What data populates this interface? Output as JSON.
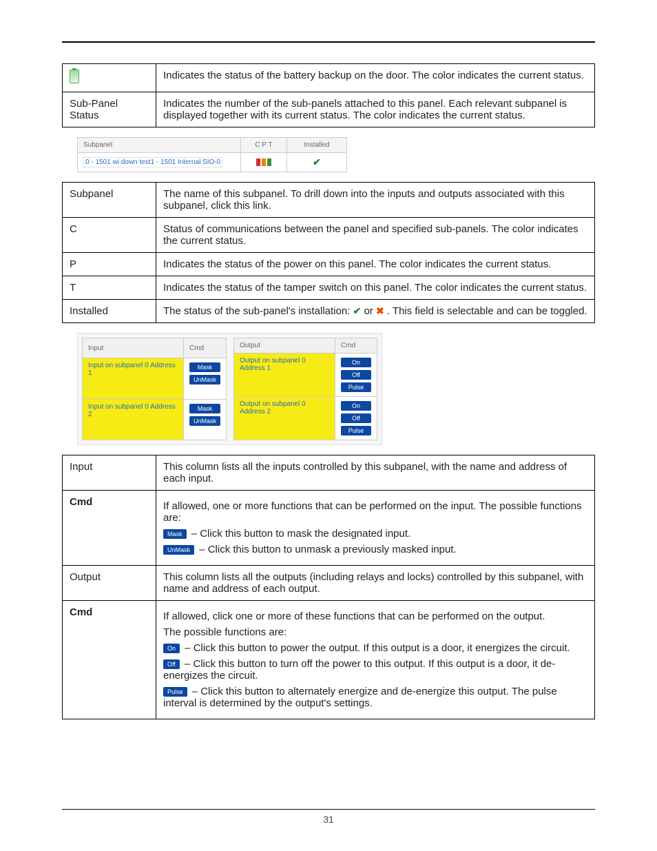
{
  "page_number": "31",
  "table1": {
    "r1label_icon_name": "battery-icon",
    "r1desc": "Indicates the status of the battery backup on the door. The color indicates the current status.",
    "r2label": "Sub-Panel Status",
    "r2desc": "Indicates the number of the sub-panels attached to this panel. Each relevant subpanel is displayed together with its current status. The color indicates the current status."
  },
  "sp_img": {
    "h_subpanel": "Subpanel",
    "h_cpt": "C P T",
    "h_installed": "Installed",
    "row_name": "0 - 1501 wi down test1 - 1501 Internal SIO-0"
  },
  "table2": {
    "r1label": "Subpanel",
    "r1desc": "The name of this subpanel. To drill down into the inputs and outputs associated with this subpanel, click this link.",
    "r2label": "C",
    "r2desc": "Status of communications between the panel and specified sub-panels. The color indicates the current status.",
    "r3label": "P",
    "r3desc": "Indicates the status of the power on this panel. The color indicates the current status.",
    "r4label": "T",
    "r4desc": "Indicates the status of the tamper switch on this panel. The color indicates the current status.",
    "r5label": "Installed",
    "r5desc_a": "The status of the sub-panel's installation: ",
    "r5desc_b": " or ",
    "r5desc_c": ". This field is selectable and can be toggled."
  },
  "io_img": {
    "h_input": "Input",
    "h_cmd": "Cmd",
    "h_output": "Output",
    "in1": "Input on subpanel 0 Address 1",
    "in2": "Input on subpanel 0 Address 2",
    "out1": "Output on subpanel 0 Address 1",
    "out2": "Output on subpanel 0 Address 2",
    "btn_mask": "Mask",
    "btn_unmask": "UnMask",
    "btn_on": "On",
    "btn_off": "Off",
    "btn_pulse": "Pulse"
  },
  "table3": {
    "r1label": "Input",
    "r1desc": "This column lists all the inputs controlled by this subpanel, with the name and address of each input.",
    "r2label": "Cmd",
    "r2p1": "If allowed, one or more functions that can be performed on the input. The possible functions are:",
    "r2p2": " – Click this button to mask the designated input.",
    "r2p3": " – Click this button to unmask a previously masked input.",
    "r3label": "Output",
    "r3desc": "This column lists all the outputs (including relays and locks) controlled by this subpanel, with name and address of each output.",
    "r4label": "Cmd",
    "r4p1": "If allowed, click one or more of these functions that can be performed on the output.",
    "r4p2": "The possible functions are:",
    "r4p3": " – Click this button to power the output. If this output is a door, it energizes the circuit.",
    "r4p4": " – Click this button to turn off the power to this output. If this output is a door, it de-energizes the circuit.",
    "r4p5": " – Click this button to alternately energize and de-energize this output. The pulse interval is determined by the output's settings."
  },
  "buttons": {
    "mask": "Mask",
    "unmask": "UnMask",
    "on": "On",
    "off": "Off",
    "pulse": "Pulse"
  }
}
